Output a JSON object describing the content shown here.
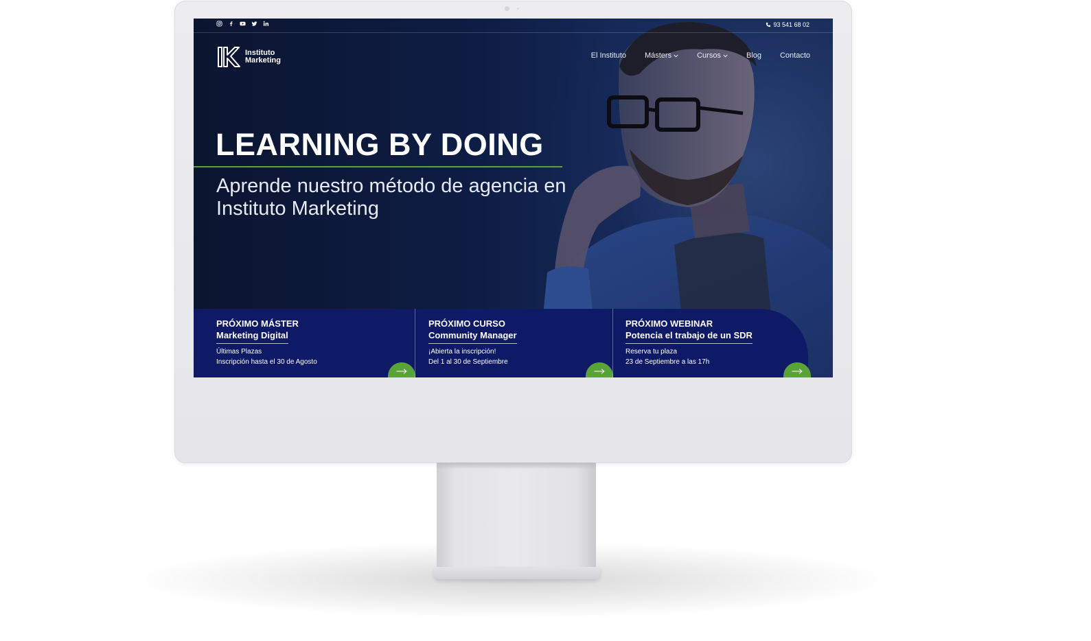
{
  "topbar": {
    "social": [
      "instagram-icon",
      "facebook-icon",
      "youtube-icon",
      "twitter-icon",
      "linkedin-icon"
    ],
    "phone": "93 541 68 02"
  },
  "logo": {
    "line1": "Instituto",
    "line2": "Marketing"
  },
  "nav": {
    "items": [
      {
        "label": "El Instituto",
        "dropdown": false
      },
      {
        "label": "Másters",
        "dropdown": true
      },
      {
        "label": "Cursos",
        "dropdown": true
      },
      {
        "label": "Blog",
        "dropdown": false
      },
      {
        "label": "Contacto",
        "dropdown": false
      }
    ]
  },
  "hero": {
    "title": "LEARNING BY DOING",
    "subtitle": "Aprende nuestro método de agencia en Instituto Marketing"
  },
  "cards": [
    {
      "eyebrow": "PRÓXIMO MÁSTER",
      "title": "Marketing Digital",
      "line1": "Últimas Plazas",
      "line2": "Inscripción hasta el 30 de Agosto"
    },
    {
      "eyebrow": "PRÓXIMO CURSO",
      "title": "Community Manager",
      "line1": "¡Abierta la inscripción!",
      "line2": "Del 1 al 30 de Septiembre"
    },
    {
      "eyebrow": "PRÓXIMO WEBINAR",
      "title": "Potencia el trabajo de un SDR",
      "line1": "Reserva tu plaza",
      "line2": "23 de Septiembre a las 17h"
    }
  ],
  "colors": {
    "accent_green": "#5aa33a",
    "card_blue": "#0e1a66",
    "hero_dark": "#0b1530"
  }
}
